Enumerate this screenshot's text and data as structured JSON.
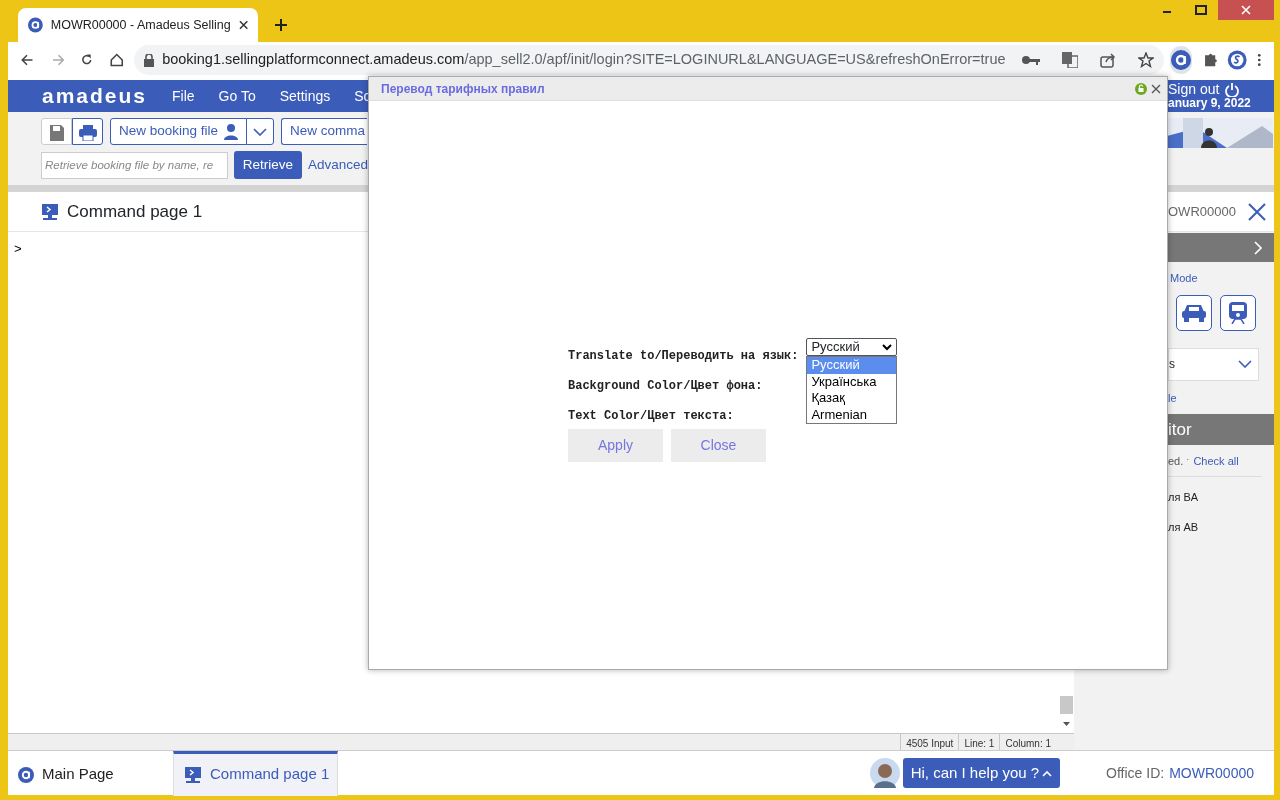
{
  "browser": {
    "tab_title": "MOWR00000 - Amadeus Selling",
    "url_host": "booking1.sellingplatformconnect.amadeus.com",
    "url_path": "/app_sell2.0/apf/init/login?SITE=LOGINURL&LANGUAGE=US&refreshOnError=true"
  },
  "app": {
    "logo": "amadeus",
    "menu": [
      "File",
      "Go To",
      "Settings",
      "Sc"
    ],
    "sign_out": "Sign out",
    "date": "anuary 9, 2022"
  },
  "toolbar": {
    "new_booking": "New booking file",
    "new_command": "New comma",
    "search_placeholder": "Retrieve booking file by name, re",
    "retrieve": "Retrieve",
    "advanced": "Advanced"
  },
  "command_page": {
    "title": "Command page 1",
    "prompt": ">",
    "office_tab": "OWR00000"
  },
  "side_panel": {
    "mode_link": "Mode",
    "select_value": "s",
    "link": "le",
    "section_title": "itor",
    "note": "ed. ˑ",
    "check_all": "Check all",
    "items": [
      "ля BA",
      "ля AB"
    ]
  },
  "status": [
    "4505 Input",
    "Line: 1",
    "Column: 1"
  ],
  "bottom": {
    "tabs": [
      {
        "label": "Main Page",
        "kind": "home",
        "selected": false
      },
      {
        "label": "Command page 1",
        "kind": "command",
        "selected": true
      }
    ],
    "assistant": "Hi, can I help you ?",
    "office_label": "Office ID:",
    "office_id": "MOWR00000"
  },
  "dialog": {
    "title": "Перевод тарифных правил",
    "fields": [
      {
        "label": "Translate to/Переводить на язык:",
        "kind": "select",
        "value": "Русский"
      },
      {
        "label": "Background Color/Цвет фона:",
        "kind": "blank"
      },
      {
        "label": "Text Color/Цвет текста:",
        "kind": "blank"
      }
    ],
    "options": [
      {
        "label": "Русский",
        "selected": true
      },
      {
        "label": "Українська",
        "selected": false
      },
      {
        "label": "Қазақ",
        "selected": false
      },
      {
        "label": "Armenian",
        "selected": false
      }
    ],
    "buttons": [
      "Apply",
      "Close"
    ]
  }
}
